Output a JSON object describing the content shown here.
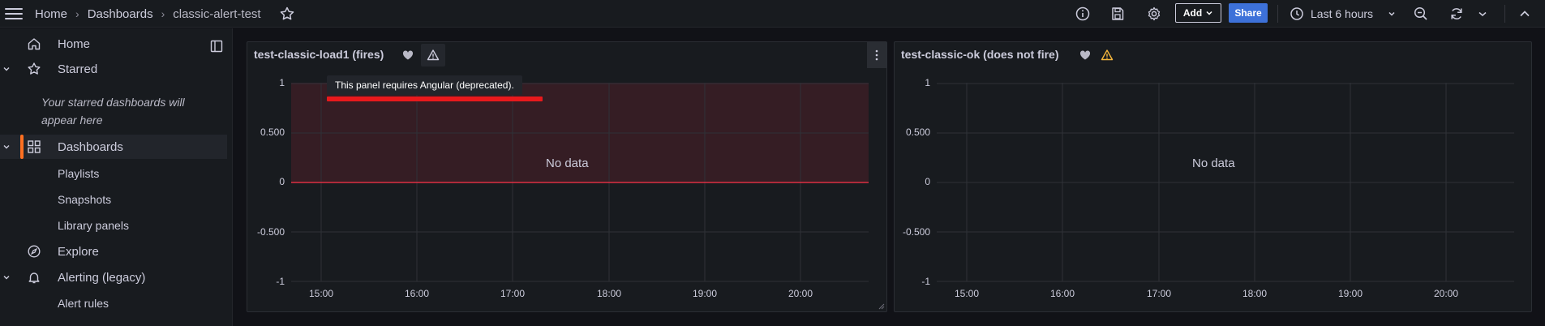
{
  "topbar": {
    "breadcrumb": [
      "Home",
      "Dashboards",
      "classic-alert-test"
    ],
    "add_label": "Add",
    "share_label": "Share",
    "time_range": "Last 6 hours"
  },
  "sidebar": {
    "home": "Home",
    "starred": "Starred",
    "starred_placeholder": "Your starred dashboards will appear here",
    "dashboards": "Dashboards",
    "playlists": "Playlists",
    "snapshots": "Snapshots",
    "library_panels": "Library panels",
    "explore": "Explore",
    "alerting": "Alerting (legacy)",
    "alert_rules": "Alert rules"
  },
  "panels": [
    {
      "title": "test-classic-load1 (fires)",
      "no_data": "No data",
      "tooltip": "This panel requires Angular (deprecated).",
      "y_ticks": [
        "1",
        "0.500",
        "0",
        "-0.500",
        "-1"
      ],
      "x_ticks": [
        "15:00",
        "16:00",
        "17:00",
        "18:00",
        "19:00",
        "20:00"
      ],
      "alert_threshold": 0,
      "alert_color": "#e02f44"
    },
    {
      "title": "test-classic-ok (does not fire)",
      "no_data": "No data",
      "y_ticks": [
        "1",
        "0.500",
        "0",
        "-0.500",
        "-1"
      ],
      "x_ticks": [
        "15:00",
        "16:00",
        "17:00",
        "18:00",
        "19:00",
        "20:00"
      ],
      "warning_color": "#f5b73d"
    }
  ],
  "colors": {
    "accent": "#ff7021",
    "primary_button": "#3d71d9",
    "annotation_red": "#e8191c"
  }
}
